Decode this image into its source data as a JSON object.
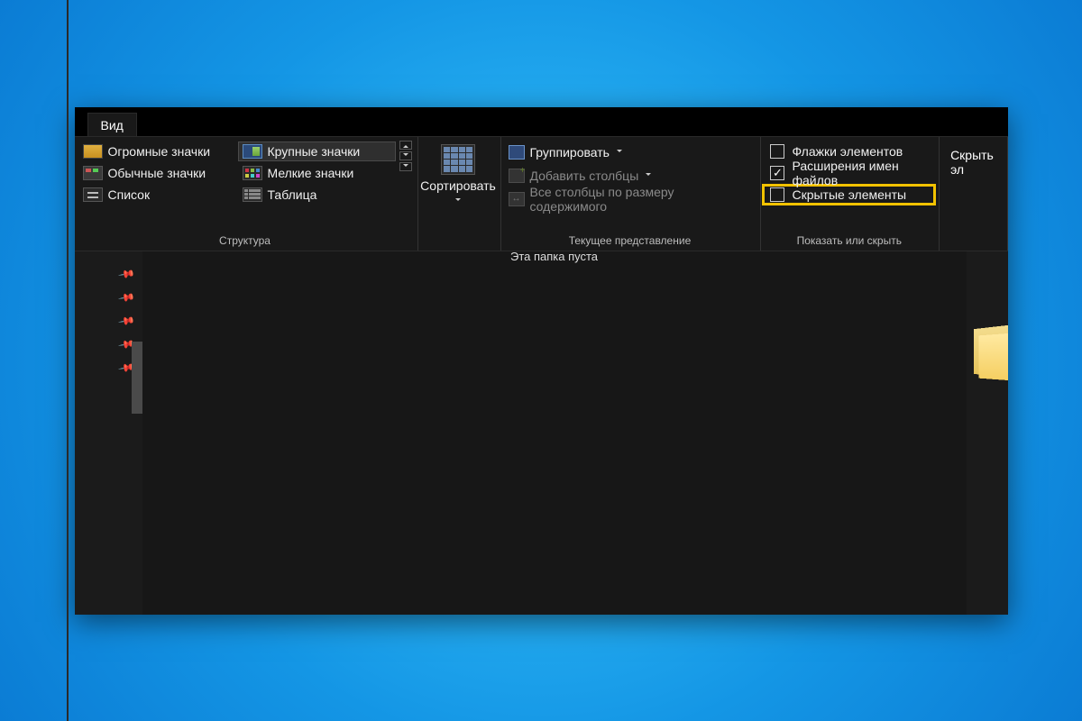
{
  "tab": {
    "label": "Вид"
  },
  "layout": {
    "label": "Структура",
    "items": [
      {
        "label": "Огромные значки",
        "icon": "huge"
      },
      {
        "label": "Крупные значки",
        "icon": "large",
        "selected": true
      },
      {
        "label": "Обычные значки",
        "icon": "medium"
      },
      {
        "label": "Мелкие значки",
        "icon": "small"
      },
      {
        "label": "Список",
        "icon": "list"
      },
      {
        "label": "Таблица",
        "icon": "table"
      }
    ]
  },
  "sort": {
    "label": "Сортировать"
  },
  "current_view": {
    "label": "Текущее представление",
    "group_by": "Группировать",
    "add_columns": "Добавить столбцы",
    "size_all": "Все столбцы по размеру содержимого"
  },
  "show_hide": {
    "label": "Показать или скрыть",
    "item_checks": {
      "label": "Флажки элементов",
      "checked": false
    },
    "file_ext": {
      "label": "Расширения имен файлов",
      "checked": true
    },
    "hidden_items": {
      "label": "Скрытые элементы",
      "checked": false,
      "highlighted": true
    }
  },
  "extra": {
    "line1": "Скрыть",
    "line2": "эл"
  },
  "content": {
    "empty_text": "Эта папка пуста"
  }
}
